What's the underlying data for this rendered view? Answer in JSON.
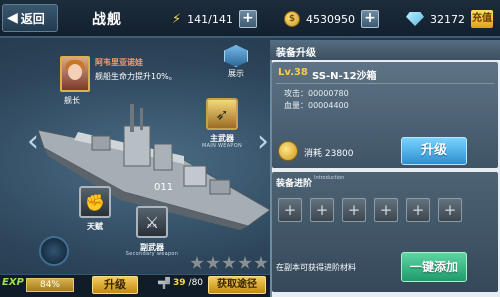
{
  "header": {
    "back_label": "返回",
    "title": "战舰",
    "fuel": "141/141",
    "gold": "4530950",
    "diamond": "32172",
    "recharge_label": "充值"
  },
  "captain": {
    "name": "阿韦里亚诺娃",
    "skill": "舰船生命力提升10%。",
    "label": "舰长"
  },
  "display_label": "展示",
  "slots": {
    "main_weapon_label": "主武器",
    "main_weapon_sub": "MAIN WEAPON",
    "talent_label": "天赋",
    "secondary_weapon_label": "副武器",
    "secondary_weapon_sub": "Secondary weapon"
  },
  "stars": {
    "filled": 0,
    "total": 5
  },
  "bottom": {
    "exp_label": "EXP",
    "exp_value": "84%",
    "upgrade_label": "升级",
    "stock_current": "39",
    "stock_sep": "/80",
    "get_route_label": "获取途径"
  },
  "equip_upgrade": {
    "title": "装备升级",
    "level": "Lv.38",
    "weapon_name": "SS-N-12沙箱",
    "attack": "攻击：00000780",
    "hp": "血量：00004400",
    "cost": "消耗 23800",
    "upgrade_button": "升级"
  },
  "advance": {
    "title": "装备进阶",
    "subtitle": "Introduction",
    "slot_count": 6,
    "tip": "在副本可获得进阶材料",
    "oneclick_button": "一键添加"
  }
}
